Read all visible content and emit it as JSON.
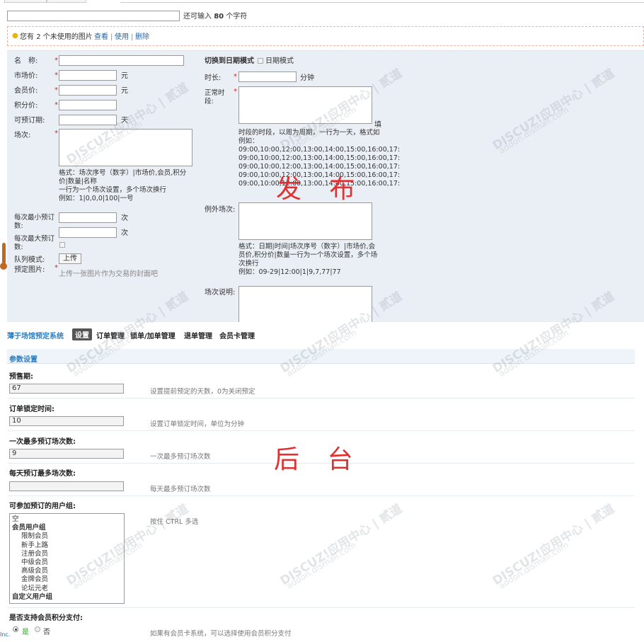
{
  "top": {
    "char_prefix": "还可输入",
    "char_count": "80",
    "char_suffix": "个字符"
  },
  "unused_images": {
    "text_a": "您有",
    "count": "2",
    "text_b": "个未使用的图片",
    "view": "查看",
    "use": "使用",
    "delete": "删除"
  },
  "publish": {
    "name_label": "名　称:",
    "market_price_label": "市场价:",
    "member_price_label": "会员价:",
    "points_price_label": "积分价:",
    "preorder_label": "可预订期:",
    "session_label": "场次:",
    "unit_yuan": "元",
    "unit_day": "天",
    "unit_minute": "分钟",
    "unit_times": "次",
    "session_note": "格式：场次序号（数字）|市场价,会员,积分\n价|数量|名称\n一行为一个场次设置，多个场次换行\n例如：1|0,0,0|100|一号",
    "min_label": "每次最小预订\n数:",
    "max_label": "每次最大预订\n数:",
    "queue_label": "队列模式:",
    "image_label": "预定图片:",
    "upload_btn": "上传",
    "upload_tip": "上传一张图片作为交易的封面吧",
    "switch_mode": "切换到日期模式",
    "date_mode": "日期模式",
    "duration_label": "时长:",
    "normal_label": "正常时\n段:",
    "fill_char": "填",
    "normal_note": "时段的时段，以周为周期，一行为一天，格式如\n例如：\n09:00,10:00,12:00,13:00,14:00,15:00,16:00,17:\n09:00,10:00,12:00,13:00,14:00,15:00,16:00,17:\n09:00,10:00,12:00,13:00,14:00,15:00,16:00,17:\n09:00,10:00,12:00,13:00,14:00,15:00,16:00,17:\n09:00,10:00,12:00,13:00,14:00,15:00,16:00,17:",
    "exception_label": "例外场次:",
    "exception_note": "格式：日期|时间|场次序号（数字）|市场价,会\n员价,积分价|数量一行为一个场次设置，多个场\n次换行\n例如：09-29|12:00|1|9,7,77|77",
    "session_desc_label": "场次说明:",
    "overlay": "发 布"
  },
  "admin": {
    "system_name": "薄于场馆预定系统",
    "nav": [
      "设置",
      "订单管理",
      "锁单/加单管理",
      "退单管理",
      "会员卡管理"
    ],
    "section_title": "参数设置",
    "fields": [
      {
        "label": "预售期:",
        "value": "67",
        "tip": "设置提前预定的天数，0为关闭预定"
      },
      {
        "label": "订单锁定时间:",
        "value": "10",
        "tip": "设置订单锁定时间，单位为分钟"
      },
      {
        "label": "一次最多预订场次数:",
        "value": "9",
        "tip": "一次最多预订场次数"
      },
      {
        "label": "每天预订最多场次数:",
        "value": "",
        "tip": "每天最多预订场次数"
      }
    ],
    "groups_label": "可参加预订的用户组:",
    "groups_tip": "按住 CTRL 多选",
    "groups": [
      {
        "text": "空",
        "bold": false,
        "indent": false
      },
      {
        "text": "会员用户组",
        "bold": true,
        "indent": false
      },
      {
        "text": "限制会员",
        "bold": false,
        "indent": true
      },
      {
        "text": "新手上路",
        "bold": false,
        "indent": true
      },
      {
        "text": "注册会员",
        "bold": false,
        "indent": true
      },
      {
        "text": "中级会员",
        "bold": false,
        "indent": true
      },
      {
        "text": "高级会员",
        "bold": false,
        "indent": true
      },
      {
        "text": "金牌会员",
        "bold": false,
        "indent": true
      },
      {
        "text": "论坛元老",
        "bold": false,
        "indent": true
      },
      {
        "text": "自定义用户组",
        "bold": true,
        "indent": false
      }
    ],
    "points_pay_label": "是否支持会员积分支付:",
    "yes": "是",
    "no": "否",
    "points_pay_tip": "如果有会员卡系统，可以选择使用会员积分支付",
    "overlay": "后 台",
    "corner_text": "Inc."
  },
  "watermark": {
    "line1": "DISCUZ!应用中心 | 贰道",
    "line2": "addon.dismall.com"
  },
  "colors": {
    "panel_bg": "#eaeff5",
    "accent_red": "#e03030",
    "link_blue": "#2366a8",
    "section_blue": "#2a7dc0"
  }
}
